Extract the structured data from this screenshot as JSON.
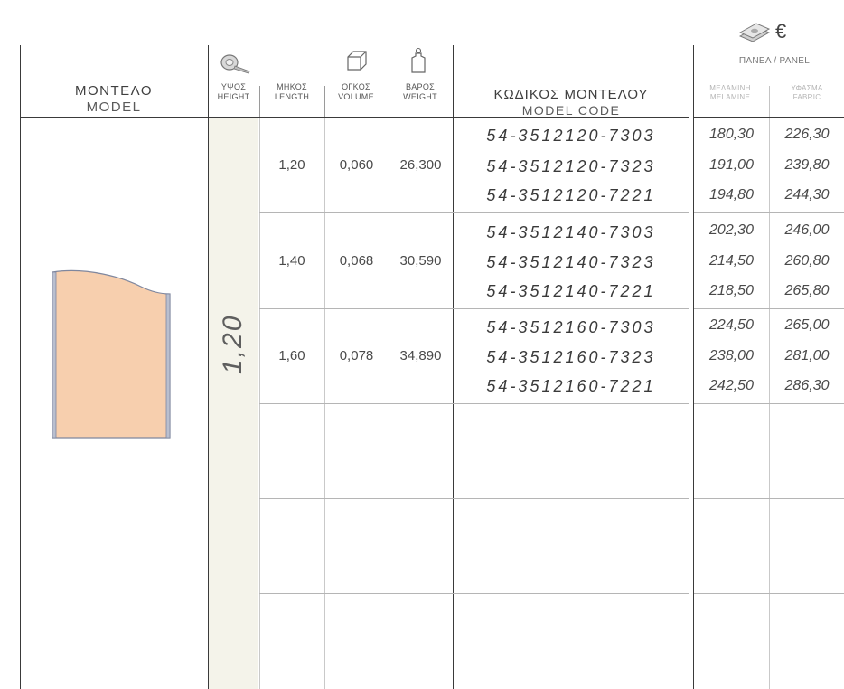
{
  "header": {
    "model_gr": "ΜΟΝΤΕΛΟ",
    "model_en": "MODEL",
    "height_gr": "ΥΨΟΣ",
    "height_en": "HEIGHT",
    "length_gr": "ΜΗΚΟΣ",
    "length_en": "LENGTH",
    "volume_gr": "ΟΓΚΟΣ",
    "volume_en": "VOLUME",
    "weight_gr": "ΒΑΡΟΣ",
    "weight_en": "WEIGHT",
    "code_gr": "ΚΩΔΙΚΟΣ ΜΟΝΤΕΛΟΥ",
    "code_en": "MODEL CODE",
    "currency": "€",
    "panel": "ΠΑΝΕΛ / PANEL",
    "melamine_gr": "ΜΕΛΑΜΙΝΗ",
    "melamine_en": "MELAMINE",
    "fabric_gr": "ΥΦΑΣΜΑ",
    "fabric_en": "FABRIC"
  },
  "height_value": "1,20",
  "groups": [
    {
      "length": "1,20",
      "volume": "0,060",
      "weight": "26,300",
      "rows": [
        {
          "code": "54-3512120-7303",
          "melamine": "180,30",
          "fabric": "226,30"
        },
        {
          "code": "54-3512120-7323",
          "melamine": "191,00",
          "fabric": "239,80"
        },
        {
          "code": "54-3512120-7221",
          "melamine": "194,80",
          "fabric": "244,30"
        }
      ]
    },
    {
      "length": "1,40",
      "volume": "0,068",
      "weight": "30,590",
      "rows": [
        {
          "code": "54-3512140-7303",
          "melamine": "202,30",
          "fabric": "246,00"
        },
        {
          "code": "54-3512140-7323",
          "melamine": "214,50",
          "fabric": "260,80"
        },
        {
          "code": "54-3512140-7221",
          "melamine": "218,50",
          "fabric": "265,80"
        }
      ]
    },
    {
      "length": "1,60",
      "volume": "0,078",
      "weight": "34,890",
      "rows": [
        {
          "code": "54-3512160-7303",
          "melamine": "224,50",
          "fabric": "265,00"
        },
        {
          "code": "54-3512160-7323",
          "melamine": "238,00",
          "fabric": "281,00"
        },
        {
          "code": "54-3512160-7221",
          "melamine": "242,50",
          "fabric": "286,30"
        }
      ]
    }
  ],
  "icons": {
    "height": "tape-measure-icon",
    "volume": "cube-icon",
    "weight": "weight-icon",
    "price": "money-icon"
  },
  "colors": {
    "panel_fill": "#f7cfae",
    "panel_edge": "#9aa0b4",
    "height_strip": "#f4f3ea"
  }
}
